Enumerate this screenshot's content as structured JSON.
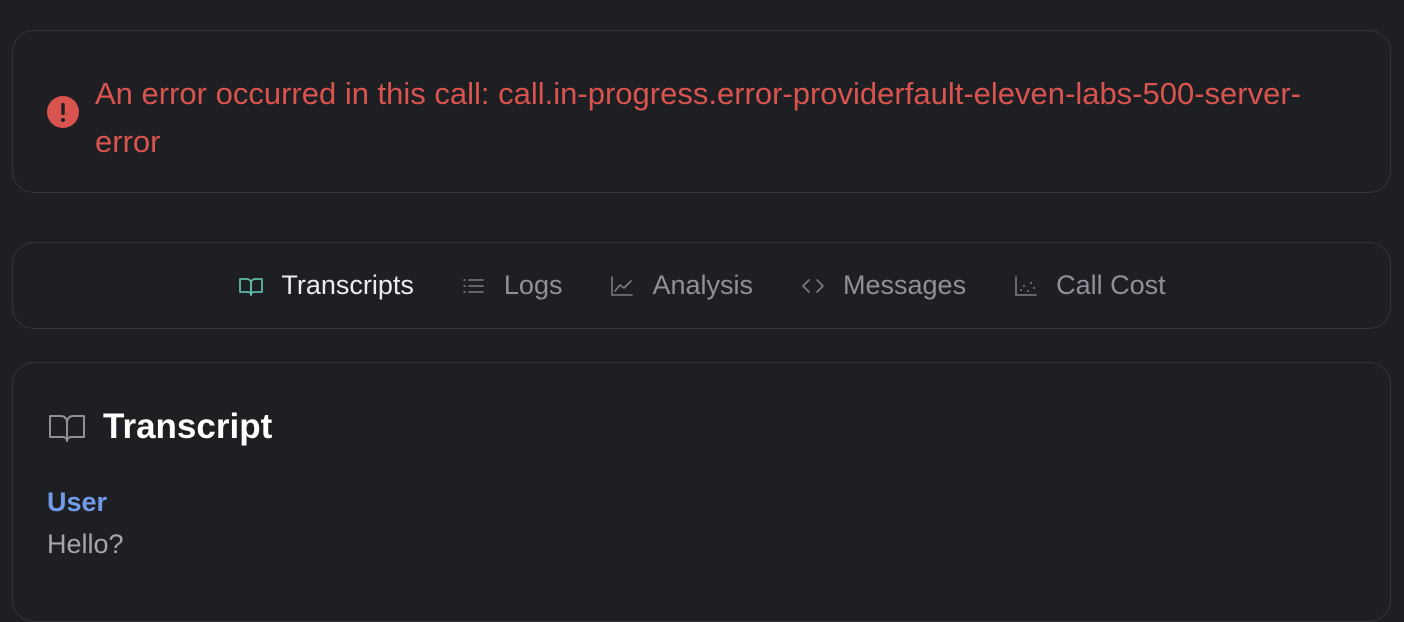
{
  "error": {
    "message": "An error occurred in this call: call.in-progress.error-providerfault-eleven-labs-500-server-error",
    "icon": "alert-circle-icon",
    "color": "#d9534f"
  },
  "tabs": [
    {
      "label": "Transcripts",
      "icon": "book-open-icon",
      "active": true
    },
    {
      "label": "Logs",
      "icon": "list-icon",
      "active": false
    },
    {
      "label": "Analysis",
      "icon": "line-chart-icon",
      "active": false
    },
    {
      "label": "Messages",
      "icon": "code-icon",
      "active": false
    },
    {
      "label": "Call Cost",
      "icon": "scatter-chart-icon",
      "active": false
    }
  ],
  "transcript": {
    "title": "Transcript",
    "icon": "book-open-icon",
    "entries": [
      {
        "speaker": "User",
        "text": "Hello?"
      }
    ]
  },
  "colors": {
    "background": "#1e1f23",
    "border": "#33353a",
    "accent_tab_icon": "#5fb9a8",
    "user_speaker": "#6f9be8",
    "error": "#d9534f"
  }
}
